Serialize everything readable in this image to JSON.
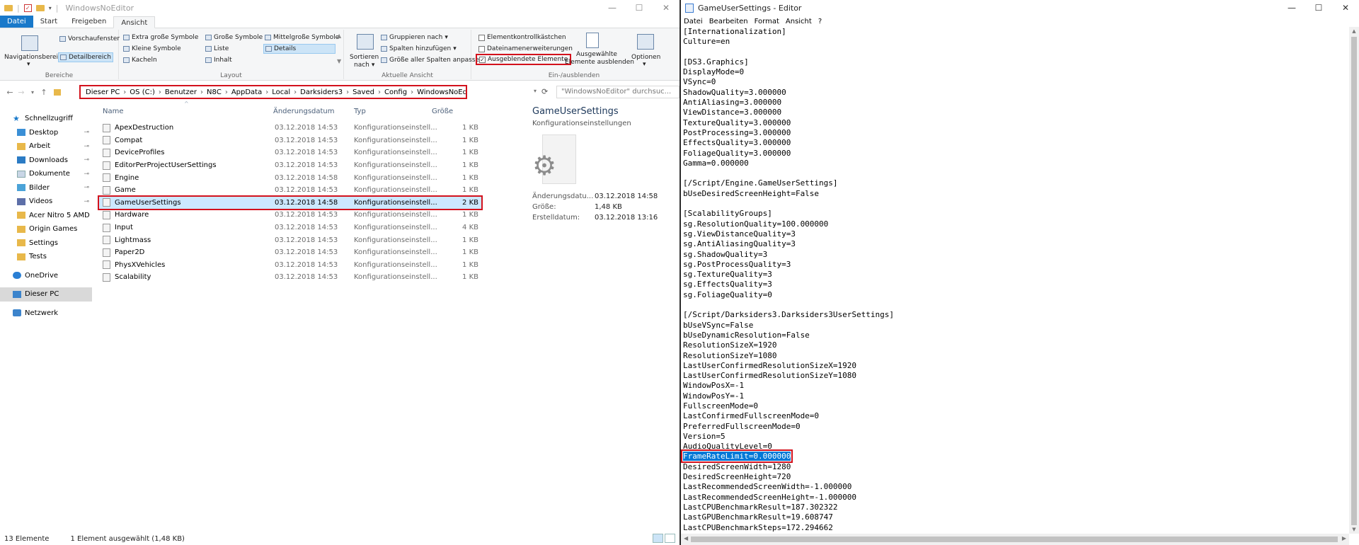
{
  "explorer": {
    "window_title": "WindowsNoEditor",
    "ribbon_tabs": [
      "Datei",
      "Start",
      "Freigeben",
      "Ansicht"
    ],
    "ribbon": {
      "bereiche": {
        "navigationsbereich": "Navigationsbereich",
        "vorschaufenster": "Vorschaufenster",
        "detailbereich": "Detailbereich",
        "label": "Bereiche"
      },
      "layout": {
        "items": [
          "Extra große Symbole",
          "Große Symbole",
          "Mittelgroße Symbole",
          "Kleine Symbole",
          "Liste",
          "Details",
          "Kacheln",
          "Inhalt"
        ],
        "label": "Layout"
      },
      "aktuelle_ansicht": {
        "sortieren_line1": "Sortieren",
        "sortieren_line2": "nach",
        "gruppieren": "Gruppieren nach",
        "spalten": "Spalten hinzufügen",
        "groesse": "Größe aller Spalten anpassen",
        "label": "Aktuelle Ansicht"
      },
      "ein_ausblenden": {
        "elementkontroll": "Elementkontrollkästchen",
        "dateinamen": "Dateinamenerweiterungen",
        "ausgeblendete": "Ausgeblendete Elemente",
        "ausgewaehlte_line1": "Ausgewählte",
        "ausgewaehlte_line2": "Elemente ausblenden",
        "optionen": "Optionen",
        "label": "Ein-/ausblenden"
      }
    },
    "breadcrumb": [
      "Dieser PC",
      "OS (C:)",
      "Benutzer",
      "N8C",
      "AppData",
      "Local",
      "Darksiders3",
      "Saved",
      "Config",
      "WindowsNoEditor"
    ],
    "search_placeholder": "\"WindowsNoEditor\" durchsuc...",
    "nav": [
      {
        "label": "Schnellzugriff",
        "icon": "star-icon",
        "indent": 0,
        "pinned": false
      },
      {
        "label": "Desktop",
        "icon": "desktop-icon",
        "indent": 1,
        "pinned": true
      },
      {
        "label": "Arbeit",
        "icon": "folder-icon",
        "indent": 1,
        "pinned": true
      },
      {
        "label": "Downloads",
        "icon": "downloads-icon",
        "indent": 1,
        "pinned": true
      },
      {
        "label": "Dokumente",
        "icon": "documents-icon",
        "indent": 1,
        "pinned": true
      },
      {
        "label": "Bilder",
        "icon": "pictures-icon",
        "indent": 1,
        "pinned": true
      },
      {
        "label": "Videos",
        "icon": "videos-icon",
        "indent": 1,
        "pinned": true
      },
      {
        "label": "Acer Nitro 5 AMD",
        "icon": "folder-icon",
        "indent": 1,
        "pinned": false
      },
      {
        "label": "Origin Games",
        "icon": "folder-icon",
        "indent": 1,
        "pinned": false
      },
      {
        "label": "Settings",
        "icon": "folder-icon",
        "indent": 1,
        "pinned": false
      },
      {
        "label": "Tests",
        "icon": "folder-icon",
        "indent": 1,
        "pinned": false
      },
      {
        "label": "OneDrive",
        "icon": "onedrive-icon",
        "indent": 0,
        "pinned": false,
        "gap": true
      },
      {
        "label": "Dieser PC",
        "icon": "pc-icon",
        "indent": 0,
        "pinned": false,
        "gap": true,
        "selected": true
      },
      {
        "label": "Netzwerk",
        "icon": "network-icon",
        "indent": 0,
        "pinned": false,
        "gap": true
      }
    ],
    "columns": {
      "name": "Name",
      "date": "Änderungsdatum",
      "type": "Typ",
      "size": "Größe"
    },
    "files": [
      {
        "name": "ApexDestruction",
        "date": "03.12.2018 14:53",
        "type": "Konfigurationseinstell...",
        "size": "1 KB"
      },
      {
        "name": "Compat",
        "date": "03.12.2018 14:53",
        "type": "Konfigurationseinstell...",
        "size": "1 KB"
      },
      {
        "name": "DeviceProfiles",
        "date": "03.12.2018 14:53",
        "type": "Konfigurationseinstell...",
        "size": "1 KB"
      },
      {
        "name": "EditorPerProjectUserSettings",
        "date": "03.12.2018 14:53",
        "type": "Konfigurationseinstell...",
        "size": "1 KB"
      },
      {
        "name": "Engine",
        "date": "03.12.2018 14:58",
        "type": "Konfigurationseinstell...",
        "size": "1 KB"
      },
      {
        "name": "Game",
        "date": "03.12.2018 14:53",
        "type": "Konfigurationseinstell...",
        "size": "1 KB"
      },
      {
        "name": "GameUserSettings",
        "date": "03.12.2018 14:58",
        "type": "Konfigurationseinstell...",
        "size": "2 KB",
        "selected": true
      },
      {
        "name": "Hardware",
        "date": "03.12.2018 14:53",
        "type": "Konfigurationseinstell...",
        "size": "1 KB"
      },
      {
        "name": "Input",
        "date": "03.12.2018 14:53",
        "type": "Konfigurationseinstell...",
        "size": "4 KB"
      },
      {
        "name": "Lightmass",
        "date": "03.12.2018 14:53",
        "type": "Konfigurationseinstell...",
        "size": "1 KB"
      },
      {
        "name": "Paper2D",
        "date": "03.12.2018 14:53",
        "type": "Konfigurationseinstell...",
        "size": "1 KB"
      },
      {
        "name": "PhysXVehicles",
        "date": "03.12.2018 14:53",
        "type": "Konfigurationseinstell...",
        "size": "1 KB"
      },
      {
        "name": "Scalability",
        "date": "03.12.2018 14:53",
        "type": "Konfigurationseinstell...",
        "size": "1 KB"
      }
    ],
    "preview": {
      "title": "GameUserSettings",
      "subtitle": "Konfigurationseinstellungen",
      "props": [
        {
          "k": "Änderungsdatu...",
          "v": "03.12.2018 14:58"
        },
        {
          "k": "Größe:",
          "v": "1,48 KB"
        },
        {
          "k": "Erstelldatum:",
          "v": "03.12.2018 13:16"
        }
      ]
    },
    "status": {
      "count": "13 Elemente",
      "selection": "1 Element ausgewählt (1,48 KB)"
    }
  },
  "notepad": {
    "title": "GameUserSettings - Editor",
    "menu": [
      "Datei",
      "Bearbeiten",
      "Format",
      "Ansicht",
      "?"
    ],
    "highlight_line": "FrameRateLimit=0.000000",
    "lines": [
      "[Internationalization]",
      "Culture=en",
      "",
      "[DS3.Graphics]",
      "DisplayMode=0",
      "VSync=0",
      "ShadowQuality=3.000000",
      "AntiAliasing=3.000000",
      "ViewDistance=3.000000",
      "TextureQuality=3.000000",
      "PostProcessing=3.000000",
      "EffectsQuality=3.000000",
      "FoliageQuality=3.000000",
      "Gamma=0.000000",
      "",
      "[/Script/Engine.GameUserSettings]",
      "bUseDesiredScreenHeight=False",
      "",
      "[ScalabilityGroups]",
      "sg.ResolutionQuality=100.000000",
      "sg.ViewDistanceQuality=3",
      "sg.AntiAliasingQuality=3",
      "sg.ShadowQuality=3",
      "sg.PostProcessQuality=3",
      "sg.TextureQuality=3",
      "sg.EffectsQuality=3",
      "sg.FoliageQuality=0",
      "",
      "[/Script/Darksiders3.Darksiders3UserSettings]",
      "bUseVSync=False",
      "bUseDynamicResolution=False",
      "ResolutionSizeX=1920",
      "ResolutionSizeY=1080",
      "LastUserConfirmedResolutionSizeX=1920",
      "LastUserConfirmedResolutionSizeY=1080",
      "WindowPosX=-1",
      "WindowPosY=-1",
      "FullscreenMode=0",
      "LastConfirmedFullscreenMode=0",
      "PreferredFullscreenMode=0",
      "Version=5",
      "AudioQualityLevel=0",
      "FrameRateLimit=0.000000",
      "DesiredScreenWidth=1280",
      "DesiredScreenHeight=720",
      "LastRecommendedScreenWidth=-1.000000",
      "LastRecommendedScreenHeight=-1.000000",
      "LastCPUBenchmarkResult=187.302322",
      "LastGPUBenchmarkResult=19.608747",
      "LastCPUBenchmarkSteps=172.294662"
    ]
  },
  "colors": {
    "accent": "#1979ca",
    "highlight_box": "#d3111c",
    "selection": "#0078d7"
  }
}
